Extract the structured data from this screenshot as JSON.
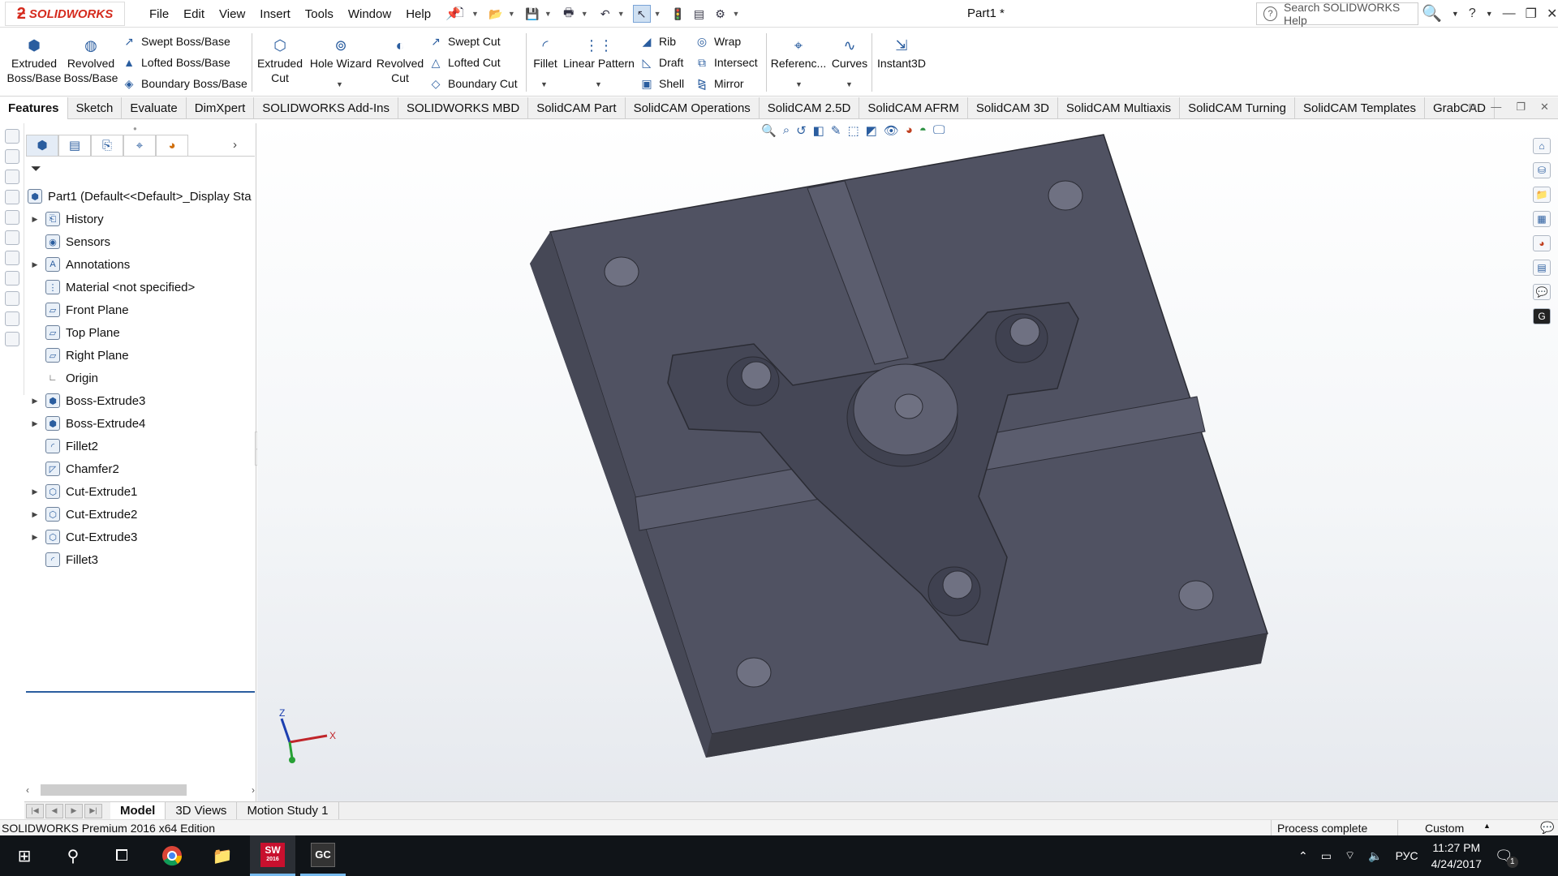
{
  "app": {
    "logo_text": "SOLIDWORKS",
    "document_title": "Part1 *"
  },
  "menu": [
    "File",
    "Edit",
    "View",
    "Insert",
    "Tools",
    "Window",
    "Help"
  ],
  "search": {
    "placeholder": "Search SOLIDWORKS Help"
  },
  "toolbar": {
    "extruded_boss": "Extruded Boss/Base",
    "revolved_boss": "Revolved Boss/Base",
    "swept_boss": "Swept Boss/Base",
    "lofted_boss": "Lofted Boss/Base",
    "boundary_boss": "Boundary Boss/Base",
    "extruded_cut": "Extruded Cut",
    "hole_wizard": "Hole Wizard",
    "revolved_cut": "Revolved Cut",
    "swept_cut": "Swept Cut",
    "lofted_cut": "Lofted Cut",
    "boundary_cut": "Boundary Cut",
    "fillet": "Fillet",
    "linear_pattern": "Linear Pattern",
    "rib": "Rib",
    "draft": "Draft",
    "shell": "Shell",
    "wrap": "Wrap",
    "intersect": "Intersect",
    "mirror": "Mirror",
    "reference": "Referenc...",
    "curves": "Curves",
    "instant3d": "Instant3D"
  },
  "tabs": [
    "Features",
    "Sketch",
    "Evaluate",
    "DimXpert",
    "SOLIDWORKS Add-Ins",
    "SOLIDWORKS MBD",
    "SolidCAM Part",
    "SolidCAM Operations",
    "SolidCAM 2.5D",
    "SolidCAM AFRM",
    "SolidCAM 3D",
    "SolidCAM Multiaxis",
    "SolidCAM Turning",
    "SolidCAM Templates",
    "GrabCAD"
  ],
  "tree": {
    "root": "Part1  (Default<<Default>_Display Sta",
    "items": [
      "History",
      "Sensors",
      "Annotations",
      "Material <not specified>",
      "Front Plane",
      "Top Plane",
      "Right Plane",
      "Origin",
      "Boss-Extrude3",
      "Boss-Extrude4",
      "Fillet2",
      "Chamfer2",
      "Cut-Extrude1",
      "Cut-Extrude2",
      "Cut-Extrude3",
      "Fillet3"
    ]
  },
  "triad": {
    "z": "Z",
    "x": "X"
  },
  "bottom_tabs": [
    "Model",
    "3D Views",
    "Motion Study 1"
  ],
  "status": {
    "edition": "SOLIDWORKS Premium 2016 x64 Edition",
    "message": "Process complete",
    "units": "Custom"
  },
  "taskbar": {
    "sw_label": "SW",
    "sw_year": "2016",
    "gc_label": "GC",
    "lang": "РУС",
    "time": "11:27 PM",
    "date": "4/24/2017",
    "notif": "1"
  }
}
